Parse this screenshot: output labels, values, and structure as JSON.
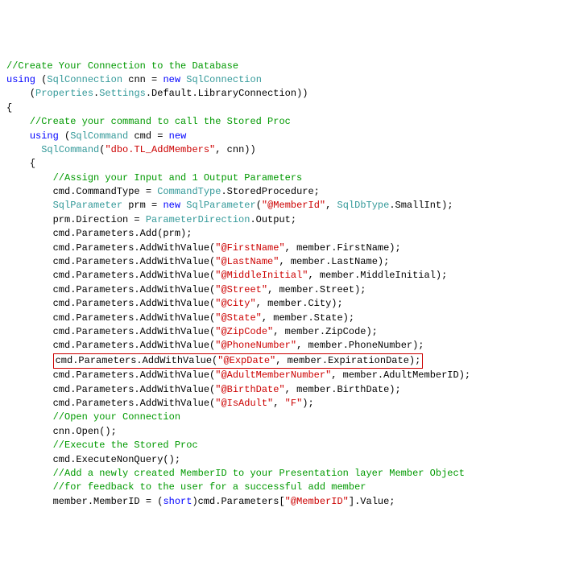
{
  "lines": [
    {
      "indent": 0,
      "parts": [
        {
          "t": "//Create Your Connection to the Database",
          "c": "comment"
        }
      ]
    },
    {
      "indent": 0,
      "parts": [
        {
          "t": "using",
          "c": "keyword"
        },
        {
          "t": " ("
        },
        {
          "t": "SqlConnection",
          "c": "type"
        },
        {
          "t": " cnn = "
        },
        {
          "t": "new",
          "c": "keyword"
        },
        {
          "t": " "
        },
        {
          "t": "SqlConnection",
          "c": "type"
        }
      ]
    },
    {
      "indent": 4,
      "parts": [
        {
          "t": "("
        },
        {
          "t": "Properties",
          "c": "type"
        },
        {
          "t": "."
        },
        {
          "t": "Settings",
          "c": "type"
        },
        {
          "t": ".Default.LibraryConnection))"
        }
      ]
    },
    {
      "indent": 0,
      "parts": [
        {
          "t": "{"
        }
      ]
    },
    {
      "indent": 4,
      "parts": [
        {
          "t": "//Create your command to call the Stored Proc",
          "c": "comment"
        }
      ]
    },
    {
      "indent": 4,
      "parts": [
        {
          "t": "using",
          "c": "keyword"
        },
        {
          "t": " ("
        },
        {
          "t": "SqlCommand",
          "c": "type"
        },
        {
          "t": " cmd = "
        },
        {
          "t": "new",
          "c": "keyword"
        }
      ]
    },
    {
      "indent": 6,
      "parts": [
        {
          "t": "SqlCommand",
          "c": "type"
        },
        {
          "t": "("
        },
        {
          "t": "\"dbo.TL_AddMembers\"",
          "c": "string"
        },
        {
          "t": ", cnn))"
        }
      ]
    },
    {
      "indent": 4,
      "parts": [
        {
          "t": "{"
        }
      ]
    },
    {
      "indent": 8,
      "parts": [
        {
          "t": "//Assign your Input and 1 Output Parameters",
          "c": "comment"
        }
      ]
    },
    {
      "indent": 8,
      "parts": [
        {
          "t": "cmd.CommandType = "
        },
        {
          "t": "CommandType",
          "c": "type"
        },
        {
          "t": ".StoredProcedure;"
        }
      ]
    },
    {
      "indent": 8,
      "parts": [
        {
          "t": "SqlParameter",
          "c": "type"
        },
        {
          "t": " prm = "
        },
        {
          "t": "new",
          "c": "keyword"
        },
        {
          "t": " "
        },
        {
          "t": "SqlParameter",
          "c": "type"
        },
        {
          "t": "("
        },
        {
          "t": "\"@MemberId\"",
          "c": "string"
        },
        {
          "t": ", "
        },
        {
          "t": "SqlDbType",
          "c": "type"
        },
        {
          "t": ".SmallInt);"
        }
      ]
    },
    {
      "indent": 8,
      "parts": [
        {
          "t": "prm.Direction = "
        },
        {
          "t": "ParameterDirection",
          "c": "type"
        },
        {
          "t": ".Output;"
        }
      ]
    },
    {
      "indent": 8,
      "parts": [
        {
          "t": "cmd.Parameters.Add(prm);"
        }
      ]
    },
    {
      "indent": 8,
      "parts": [
        {
          "t": "cmd.Parameters.AddWithValue("
        },
        {
          "t": "\"@FirstName\"",
          "c": "string"
        },
        {
          "t": ", member.FirstName);"
        }
      ]
    },
    {
      "indent": 8,
      "parts": [
        {
          "t": "cmd.Parameters.AddWithValue("
        },
        {
          "t": "\"@LastName\"",
          "c": "string"
        },
        {
          "t": ", member.LastName);"
        }
      ]
    },
    {
      "indent": 8,
      "parts": [
        {
          "t": "cmd.Parameters.AddWithValue("
        },
        {
          "t": "\"@MiddleInitial\"",
          "c": "string"
        },
        {
          "t": ", member.MiddleInitial);"
        }
      ]
    },
    {
      "indent": 8,
      "parts": [
        {
          "t": "cmd.Parameters.AddWithValue("
        },
        {
          "t": "\"@Street\"",
          "c": "string"
        },
        {
          "t": ", member.Street);"
        }
      ]
    },
    {
      "indent": 8,
      "parts": [
        {
          "t": "cmd.Parameters.AddWithValue("
        },
        {
          "t": "\"@City\"",
          "c": "string"
        },
        {
          "t": ", member.City);"
        }
      ]
    },
    {
      "indent": 8,
      "parts": [
        {
          "t": "cmd.Parameters.AddWithValue("
        },
        {
          "t": "\"@State\"",
          "c": "string"
        },
        {
          "t": ", member.State);"
        }
      ]
    },
    {
      "indent": 8,
      "parts": [
        {
          "t": "cmd.Parameters.AddWithValue("
        },
        {
          "t": "\"@ZipCode\"",
          "c": "string"
        },
        {
          "t": ", member.ZipCode);"
        }
      ]
    },
    {
      "indent": 8,
      "parts": [
        {
          "t": "cmd.Parameters.AddWithValue("
        },
        {
          "t": "\"@PhoneNumber\"",
          "c": "string"
        },
        {
          "t": ", member.PhoneNumber);"
        }
      ]
    },
    {
      "indent": 8,
      "highlight": true,
      "parts": [
        {
          "t": "cmd.Parameters.AddWithValue("
        },
        {
          "t": "\"@ExpDate\"",
          "c": "string"
        },
        {
          "t": ", member.ExpirationDate);"
        }
      ]
    },
    {
      "indent": 8,
      "parts": [
        {
          "t": "cmd.Parameters.AddWithValue("
        },
        {
          "t": "\"@AdultMemberNumber\"",
          "c": "string"
        },
        {
          "t": ", member.AdultMemberID);"
        }
      ]
    },
    {
      "indent": 8,
      "parts": [
        {
          "t": "cmd.Parameters.AddWithValue("
        },
        {
          "t": "\"@BirthDate\"",
          "c": "string"
        },
        {
          "t": ", member.BirthDate);"
        }
      ]
    },
    {
      "indent": 8,
      "parts": [
        {
          "t": "cmd.Parameters.AddWithValue("
        },
        {
          "t": "\"@IsAdult\"",
          "c": "string"
        },
        {
          "t": ", "
        },
        {
          "t": "\"F\"",
          "c": "string"
        },
        {
          "t": ");"
        }
      ]
    },
    {
      "indent": 8,
      "parts": [
        {
          "t": "//Open your Connection",
          "c": "comment"
        }
      ]
    },
    {
      "indent": 8,
      "parts": [
        {
          "t": "cnn.Open();"
        }
      ]
    },
    {
      "indent": 8,
      "parts": [
        {
          "t": "//Execute the Stored Proc",
          "c": "comment"
        }
      ]
    },
    {
      "indent": 8,
      "parts": [
        {
          "t": "cmd.ExecuteNonQuery();"
        }
      ]
    },
    {
      "indent": 8,
      "parts": [
        {
          "t": "//Add a newly created MemberID to your Presentation layer Member Object",
          "c": "comment"
        }
      ]
    },
    {
      "indent": 8,
      "parts": [
        {
          "t": "//for feedback to the user for a successful add member",
          "c": "comment"
        }
      ]
    },
    {
      "indent": 8,
      "parts": [
        {
          "t": "member.MemberID = ("
        },
        {
          "t": "short",
          "c": "keyword"
        },
        {
          "t": ")cmd.Parameters["
        },
        {
          "t": "\"@MemberID\"",
          "c": "string"
        },
        {
          "t": "].Value;"
        }
      ]
    }
  ]
}
